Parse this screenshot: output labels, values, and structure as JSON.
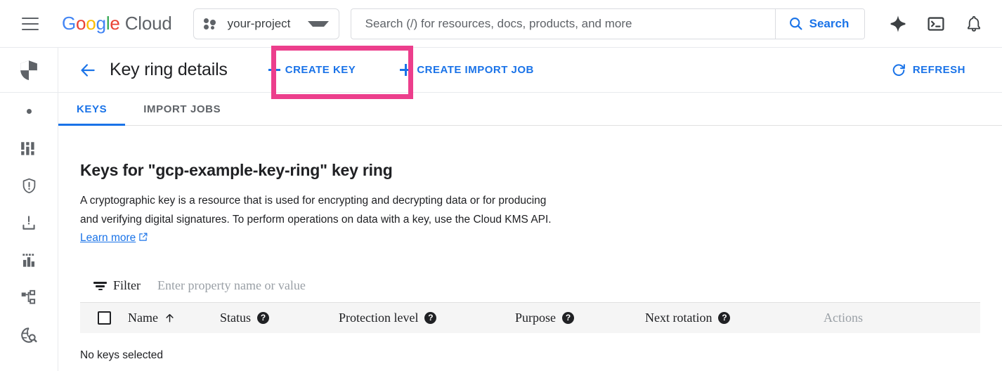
{
  "colors": {
    "accent": "#1a73e8",
    "highlight": "#EC3E8C",
    "text": "#202124",
    "muted": "#5f6368",
    "table_header_bg": "#f5f5f5",
    "actions_header": "#9aa0a6"
  },
  "topbar": {
    "menu_icon": "hamburger-menu-icon",
    "brand": {
      "g1": "G",
      "o1": "o",
      "o2": "o",
      "g2": "g",
      "l1": "l",
      "e1": "e",
      "cloud": " Cloud"
    },
    "project_selector": {
      "icon": "project-dots-icon",
      "value": "your-project",
      "caret_icon": "chevron-down-icon"
    },
    "search": {
      "placeholder": "Search (/) for resources, docs, products, and more",
      "value": "",
      "button_label": "Search",
      "button_icon": "search-icon"
    },
    "icons": [
      {
        "name": "gemini-sparkle-icon",
        "label": "Gemini"
      },
      {
        "name": "cloud-shell-terminal-icon",
        "label": "Activate Cloud Shell"
      },
      {
        "name": "notifications-bell-icon",
        "label": "Notifications"
      }
    ]
  },
  "rail": {
    "product_icon": "security-shield-icon",
    "items": [
      {
        "name": "rail-item-dot",
        "icon": "dot-icon"
      },
      {
        "name": "rail-item-dashboard",
        "icon": "dashboard-blocks-icon"
      },
      {
        "name": "rail-item-shield-alert",
        "icon": "shield-exclamation-icon"
      },
      {
        "name": "rail-item-download",
        "icon": "download-tray-icon"
      },
      {
        "name": "rail-item-chart",
        "icon": "bar-chart-icon"
      },
      {
        "name": "rail-item-hierarchy",
        "icon": "hierarchy-tree-icon"
      },
      {
        "name": "rail-item-asset-search",
        "icon": "globe-search-icon"
      }
    ]
  },
  "page": {
    "back_icon": "arrow-left-icon",
    "title": "Key ring details",
    "create_key_label": "CREATE KEY",
    "create_import_job_label": "CREATE IMPORT JOB",
    "refresh_label": "REFRESH",
    "refresh_icon": "refresh-icon",
    "highlighted_element": "create-key-button"
  },
  "tabs": [
    {
      "label": "KEYS",
      "active": true
    },
    {
      "label": "IMPORT JOBS",
      "active": false
    }
  ],
  "main": {
    "heading": "Keys for \"gcp-example-key-ring\" key ring",
    "description_part1": "A cryptographic key is a resource that is used for encrypting and decrypting data or for producing and verifying digital signatures. To perform operations on data with a key, use the Cloud KMS API.",
    "learn_more_label": "Learn more",
    "learn_more_icon": "external-link-icon",
    "filter": {
      "icon": "filter-lines-icon",
      "label": "Filter",
      "placeholder": "Enter property name or value",
      "value": ""
    },
    "table": {
      "select_all_checkbox": false,
      "columns": [
        {
          "label": "Name",
          "sort": "asc",
          "sort_icon": "arrow-up-icon",
          "help": false
        },
        {
          "label": "Status",
          "help": true,
          "help_icon": "help-circle-icon"
        },
        {
          "label": "Protection level",
          "help": true,
          "help_icon": "help-circle-icon"
        },
        {
          "label": "Purpose",
          "help": true,
          "help_icon": "help-circle-icon"
        },
        {
          "label": "Next rotation",
          "help": true,
          "help_icon": "help-circle-icon"
        },
        {
          "label": "Actions",
          "help": false
        }
      ],
      "rows": [],
      "empty_state": "No keys selected"
    }
  }
}
